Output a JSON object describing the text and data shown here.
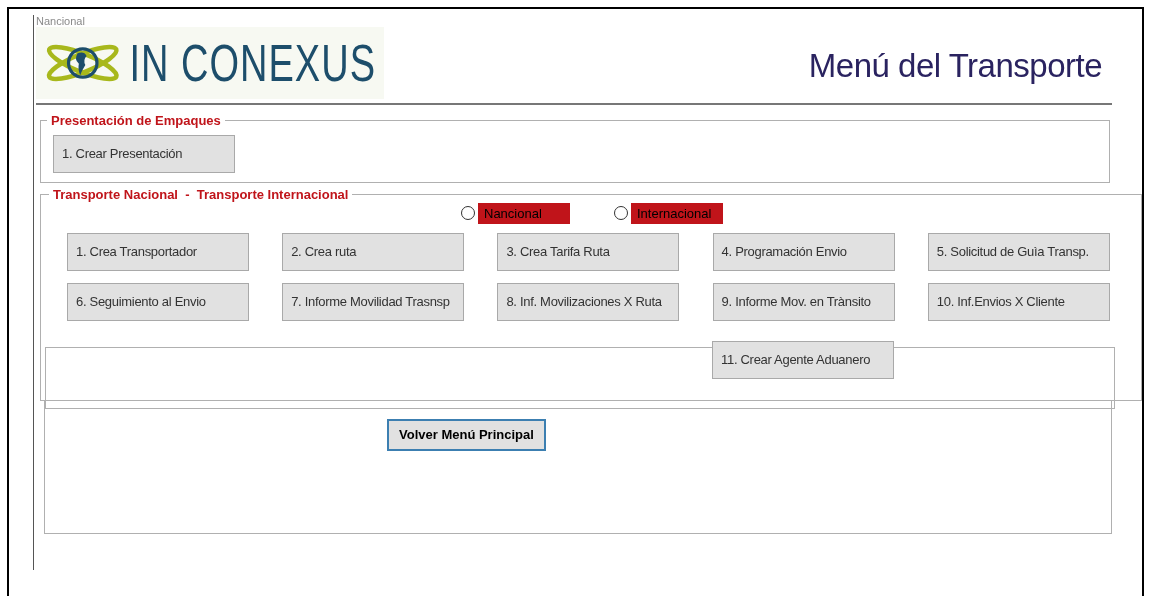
{
  "stray_label": "Nancional",
  "logo": {
    "text": "IN CONEXUS"
  },
  "page_title": "Menú del Transporte",
  "packaging_section": {
    "legend": "Presentación de Empaques",
    "buttons": [
      "1. Crear Presentación"
    ]
  },
  "transport_section": {
    "legend": "Transporte Nacional  -  Transporte Internacional",
    "radios": [
      {
        "label": "Nancional",
        "selected": false
      },
      {
        "label": "Internacional",
        "selected": false
      }
    ],
    "buttons": [
      "1. Crea Transportador",
      "2. Crea ruta",
      "3. Crea Tarifa Ruta",
      "4. Programación Envio",
      "5. Solicitud de Guìa Transp.",
      "6. Seguimiento al Envio",
      "7. Informe Movilidad Trasnsp",
      "8. Inf. Movilizaciones X Ruta",
      "9. Informe Mov. en Trànsito",
      "10. Inf.Envios X Cliente"
    ]
  },
  "customs_button": "11. Crear Agente Aduanero",
  "back_button": "Volver Menú Principal"
}
